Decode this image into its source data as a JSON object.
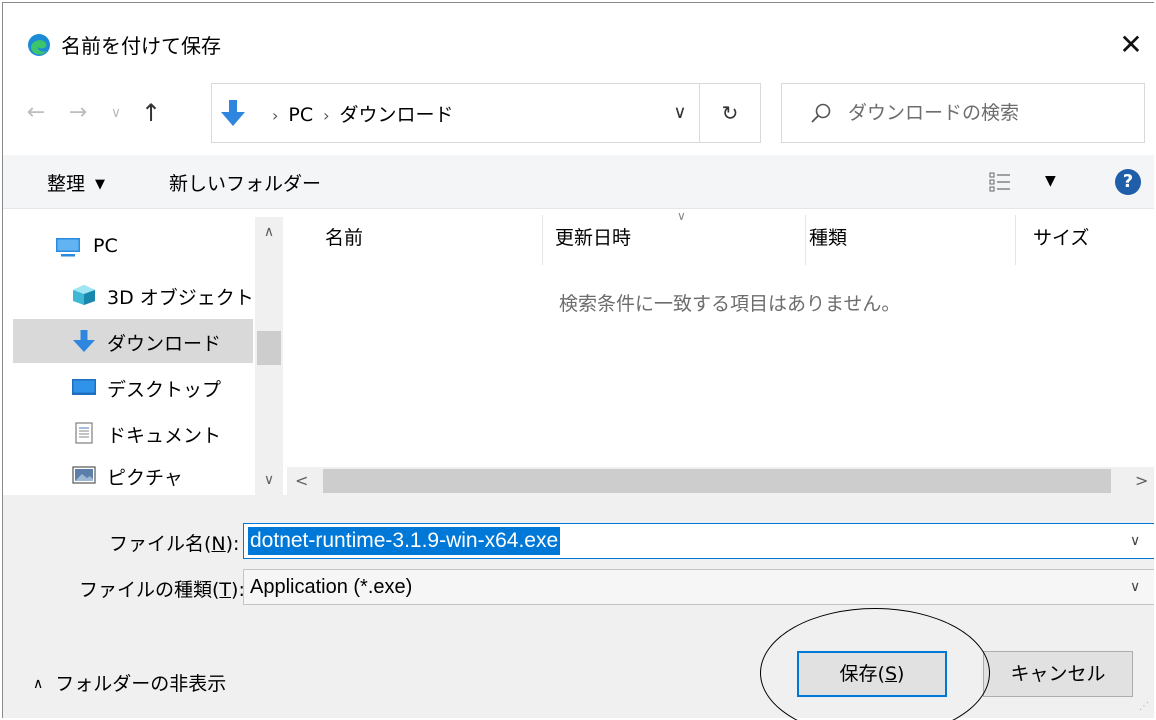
{
  "window": {
    "title": "名前を付けて保存",
    "close_glyph": "✕"
  },
  "address_bar": {
    "back_glyph": "←",
    "forward_glyph": "→",
    "recent_glyph": "∨",
    "up_glyph": "↑",
    "path": [
      "PC",
      "ダウンロード"
    ],
    "separator": "›",
    "dropdown_glyph": "∨",
    "refresh_glyph": "↻"
  },
  "search": {
    "placeholder": "ダウンロードの検索"
  },
  "toolbar": {
    "organize_label": "整理",
    "organize_caret": "▼",
    "new_folder_label": "新しいフォルダー",
    "view_caret": "▼",
    "help_label": "?"
  },
  "nav_pane": {
    "items": [
      {
        "label": "PC",
        "icon": "pc-icon",
        "selected": false
      },
      {
        "label": "3D オブジェクト",
        "icon": "3d-objects-icon",
        "selected": false
      },
      {
        "label": "ダウンロード",
        "icon": "download-arrow-icon",
        "selected": true
      },
      {
        "label": "デスクトップ",
        "icon": "desktop-icon",
        "selected": false
      },
      {
        "label": "ドキュメント",
        "icon": "document-icon",
        "selected": false
      },
      {
        "label": "ピクチャ",
        "icon": "pictures-icon",
        "selected": false
      }
    ],
    "scroll_up_glyph": "∧",
    "scroll_down_glyph": "∨"
  },
  "file_list": {
    "columns": [
      "名前",
      "更新日時",
      "種類",
      "サイズ"
    ],
    "sort_glyph": "∨",
    "empty_message": "検索条件に一致する項目はありません。",
    "scroll_left_glyph": "<",
    "scroll_right_glyph": ">"
  },
  "form": {
    "filename_label": "ファイル名(",
    "filename_accel": "N",
    "filename_label_end": "):",
    "filename_value": "dotnet-runtime-3.1.9-win-x64.exe",
    "filetype_label": "ファイルの種類(",
    "filetype_accel": "T",
    "filetype_label_end": "):",
    "filetype_value": "Application (*.exe)",
    "dropdown_glyph": "∨",
    "hide_folders_caret": "∧",
    "hide_folders_label": "フォルダーの非表示",
    "save_label": "保存(",
    "save_accel": "S",
    "save_label_end": ")",
    "cancel_label": "キャンセル"
  },
  "colors": {
    "accent": "#0078d7",
    "selected_bg": "#d9d9d9",
    "help_blue": "#1f5ea8"
  }
}
